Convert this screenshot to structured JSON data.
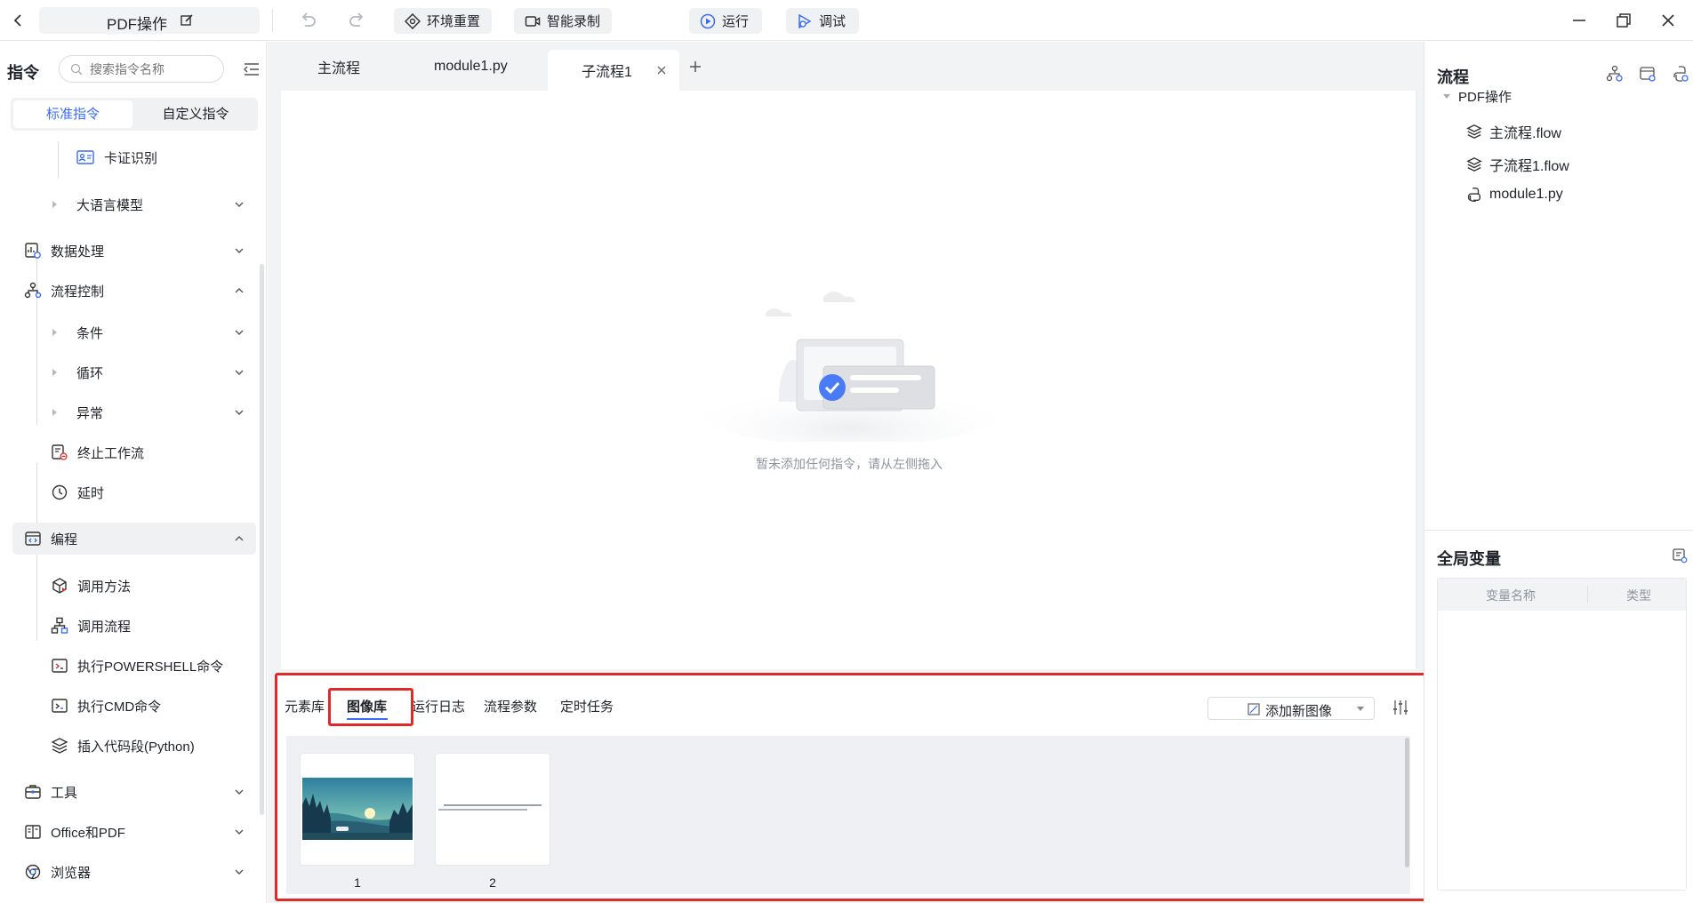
{
  "titlebar": {
    "project_name": "PDF操作",
    "btn_reset": "环境重置",
    "btn_record": "智能录制",
    "btn_run": "运行",
    "btn_debug": "调试"
  },
  "sidebar": {
    "title": "指令",
    "search_placeholder": "搜索指令名称",
    "tab_standard": "标准指令",
    "tab_custom": "自定义指令",
    "items": {
      "card_ocr": "卡证识别",
      "llm": "大语言模型",
      "data_process": "数据处理",
      "flow_control": "流程控制",
      "condition": "条件",
      "loop": "循环",
      "exception": "异常",
      "terminate": "终止工作流",
      "delay": "延时",
      "programming": "编程",
      "call_method": "调用方法",
      "call_flow": "调用流程",
      "exec_powershell": "执行POWERSHELL命令",
      "exec_cmd": "执行CMD命令",
      "insert_python": "插入代码段(Python)",
      "tools": "工具",
      "office_pdf": "Office和PDF",
      "browser": "浏览器"
    }
  },
  "editor": {
    "tabs": [
      "主流程",
      "module1.py",
      "子流程1"
    ],
    "empty_text": "暂未添加任何指令，请从左侧拖入"
  },
  "bottom": {
    "tabs": [
      "元素库",
      "图像库",
      "运行日志",
      "流程参数",
      "定时任务"
    ],
    "active_tab": "图像库",
    "add_image": "添加新图像",
    "images": [
      {
        "label": "1"
      },
      {
        "label": "2"
      }
    ]
  },
  "right": {
    "flow_title": "流程",
    "root": "PDF操作",
    "files": [
      "主流程.flow",
      "子流程1.flow",
      "module1.py"
    ],
    "globals_title": "全局变量",
    "col_name": "变量名称",
    "col_type": "类型"
  },
  "colors": {
    "accent": "#3b6cf6",
    "highlight": "#e02a2a"
  }
}
